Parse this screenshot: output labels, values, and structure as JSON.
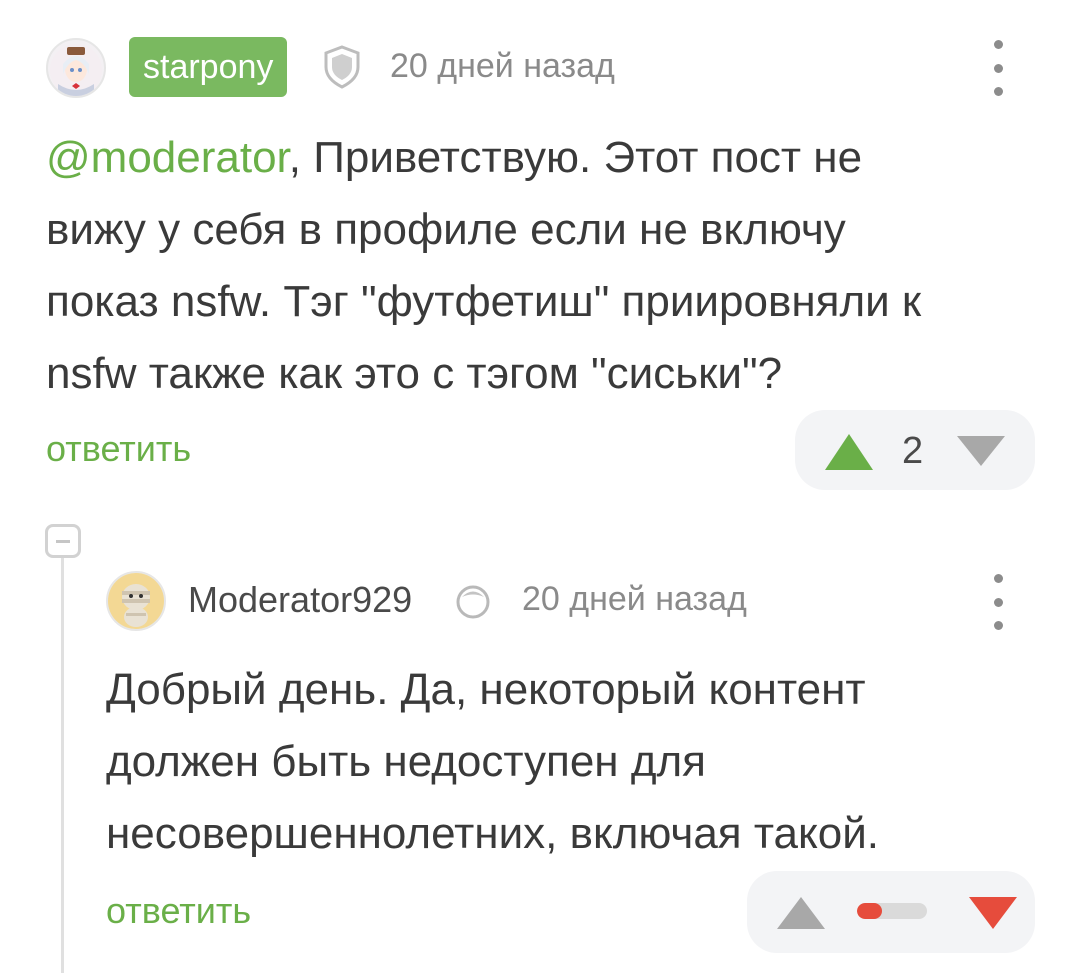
{
  "comment": {
    "author": "starpony",
    "time": "20 дней назад",
    "mention": "@moderator",
    "lines": [
      ", Приветствую. Этот пост не",
      "вижу у себя в профиле если не включу",
      "показ nsfw. Тэг \"футфетиш\" приировняли к",
      "nsfw также как это с тэгом \"сиськи\"?"
    ],
    "reply_label": "ответить",
    "votes": "2"
  },
  "reply": {
    "author": "Moderator929",
    "time": "20 дней назад",
    "lines": [
      "Добрый день. Да, некоторый контент",
      "должен быть недоступен для",
      "несовершеннолетних, включая такой."
    ],
    "reply_label": "ответить",
    "rating_fraction": 0.35
  },
  "colors": {
    "accent_green": "#7ab960",
    "link_green": "#6aaf48",
    "downvote_red": "#e64c3c"
  },
  "icons": {
    "author_badge": "shield-icon",
    "moderator_badge": "moderator-ring-icon",
    "more": "more-vertical-icon",
    "collapse": "collapse-thread-icon"
  }
}
